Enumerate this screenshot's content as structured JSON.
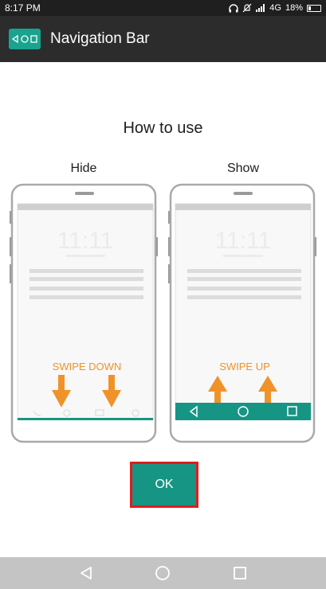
{
  "status_bar": {
    "time": "8:17 PM",
    "network": "4G",
    "battery": "18%"
  },
  "app_bar": {
    "title": "Navigation Bar",
    "icon": "navigation-bar-app-icon"
  },
  "tutorial": {
    "heading": "How to use",
    "hide_label": "Hide",
    "show_label": "Show",
    "clock_text": "11:11",
    "swipe_down": "SWIPE DOWN",
    "swipe_up": "SWIPE UP"
  },
  "ok_button": "OK",
  "colors": {
    "accent": "#169585",
    "arrow": "#f0922a",
    "highlight_border": "#e01b1b"
  },
  "system_nav": {
    "back_icon": "back-triangle-icon",
    "home_icon": "home-circle-icon",
    "recents_icon": "recents-square-icon"
  }
}
